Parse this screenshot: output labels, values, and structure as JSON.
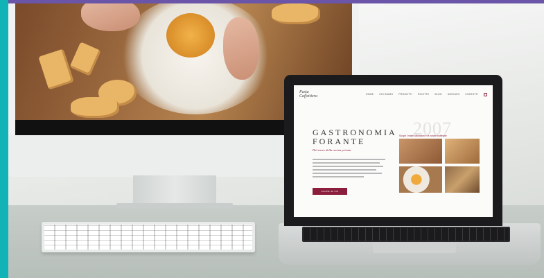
{
  "scene": {
    "colors": {
      "accent_top": "#6b55a8",
      "accent_left": "#12b3b7",
      "brand": "#8a1e3c"
    }
  },
  "website": {
    "logo": "Pasta Caffettiera",
    "menu": [
      "HOME",
      "CHI SIAMO",
      "PRODOTTI",
      "RICETTE",
      "BLOG",
      "NEGOZIO",
      "CONTATTI"
    ],
    "title": "GASTRONOMIA FORANTE",
    "tagline": "Dal cuore della cucina privata",
    "button_label": "SCOPRI DI PIÙ",
    "year": "2007",
    "gallery_caption": "Scopri i nostri laboratori e le nostre botteghe"
  }
}
